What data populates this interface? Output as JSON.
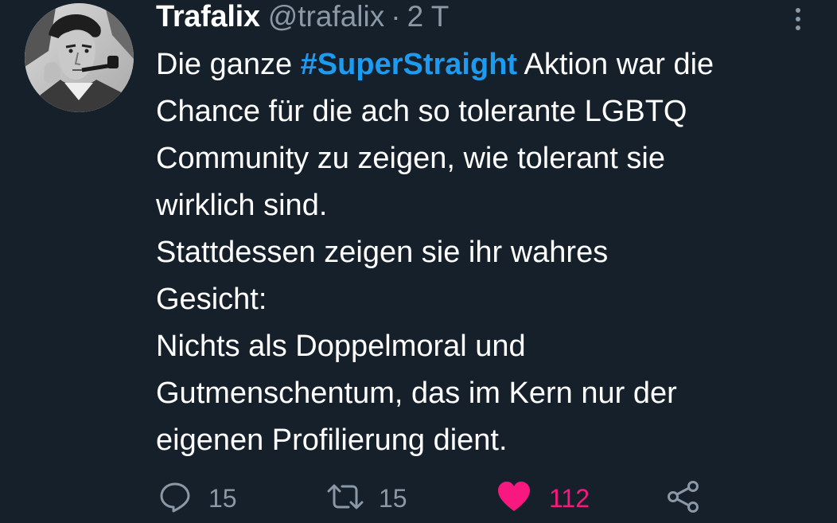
{
  "tweet": {
    "author_name": "Trafalix",
    "handle": "@trafalix",
    "separator": "·",
    "time": "2 T",
    "body_pre": "Die ganze ",
    "hashtag": "#SuperStraight",
    "body_lines": [
      " Aktion war die",
      "Chance für die ach so tolerante LGBTQ",
      "Community zu zeigen, wie tolerant sie",
      "wirklich sind.",
      "Stattdessen zeigen sie ihr wahres",
      "Gesicht:",
      "Nichts als Doppelmoral und",
      "Gutmenschentum, das im Kern nur der",
      "eigenen Profilierung dient."
    ]
  },
  "actions": {
    "reply_count": "15",
    "retweet_count": "15",
    "like_count": "112",
    "like_active": true
  },
  "icons": {
    "reply": "reply-icon",
    "retweet": "retweet-icon",
    "like": "heart-icon",
    "share": "share-icon",
    "more": "more-vertical-icon"
  },
  "colors": {
    "background": "#15202b",
    "hashtag": "#1d9bf0",
    "secondary_text": "#8b98a5",
    "like": "#f91880"
  }
}
